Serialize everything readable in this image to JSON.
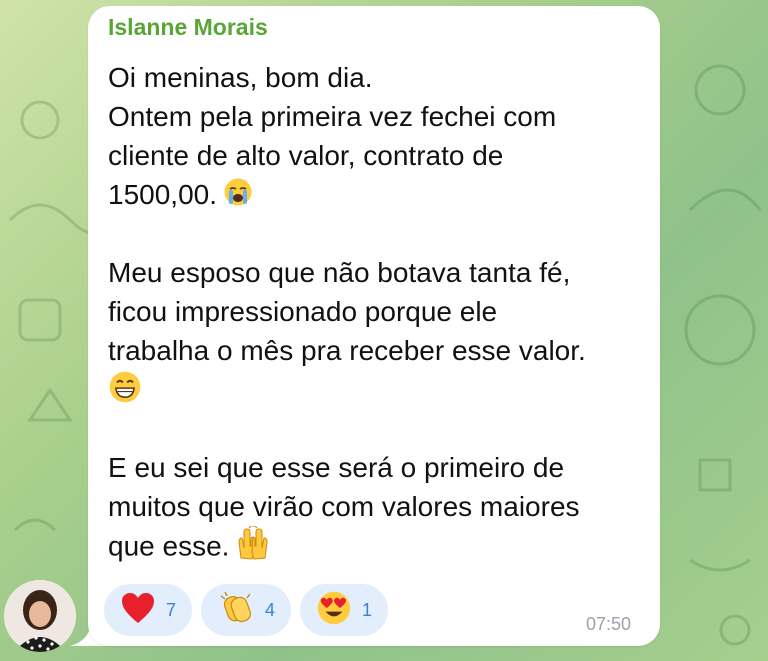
{
  "message": {
    "sender": "Islanne Morais",
    "lines": [
      "Oi meninas, bom dia.",
      "Ontem pela primeira vez fechei com",
      "cliente de alto valor, contrato de",
      "1500,00.",
      "",
      "Meu esposo que não botava tanta fé,",
      "ficou impressionado porque ele",
      "trabalha o mês pra receber esse valor.",
      "",
      "",
      "E eu sei que esse será o primeiro de",
      "muitos que virão com valores maiores",
      "que esse."
    ],
    "emojis": {
      "line_4": "crying-face-emoji",
      "line_9": "grinning-face-emoji",
      "line_13": "raising-hands-emoji"
    },
    "time": "07:50"
  },
  "reactions": [
    {
      "icon": "red-heart-icon",
      "count": "7"
    },
    {
      "icon": "clapping-hands-icon",
      "count": "4"
    },
    {
      "icon": "heart-eyes-icon",
      "count": "1"
    }
  ],
  "colors": {
    "sender_name": "#5aa537",
    "reaction_bg": "#e2eefc",
    "reaction_count": "#3b82d6",
    "timestamp": "#9aa3ab",
    "bubble": "#ffffff",
    "wallpaper": "#a9cf8c"
  }
}
